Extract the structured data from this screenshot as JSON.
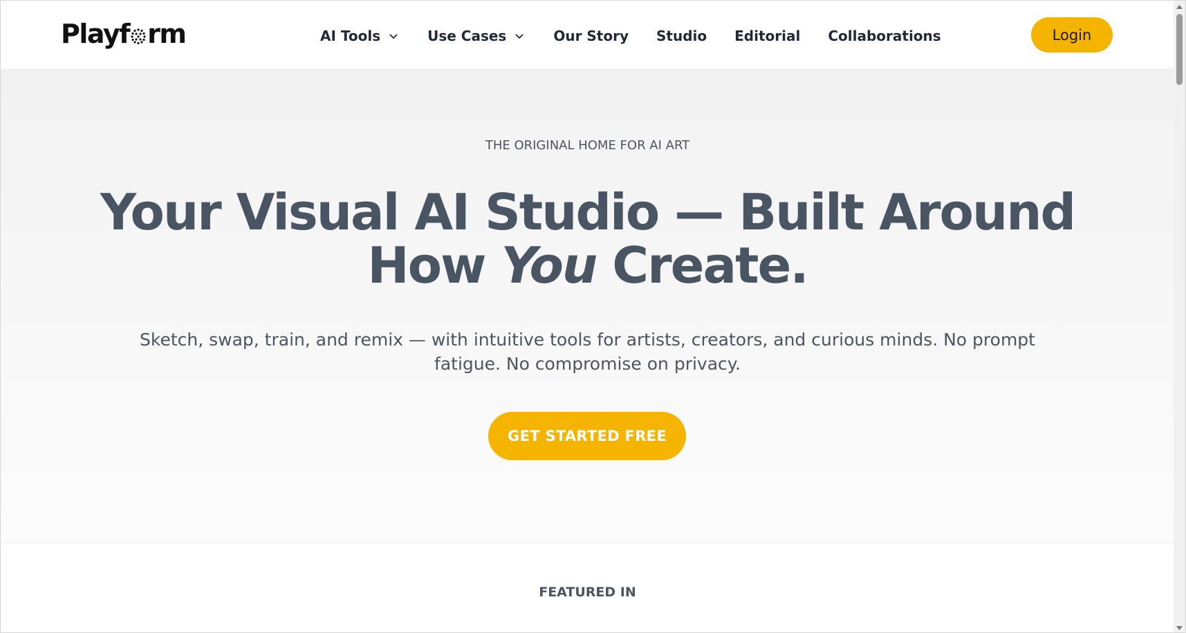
{
  "header": {
    "logo_prefix": "Playf",
    "logo_suffix": "rm",
    "nav": [
      {
        "label": "AI Tools",
        "has_dropdown": true
      },
      {
        "label": "Use Cases",
        "has_dropdown": true
      },
      {
        "label": "Our Story",
        "has_dropdown": false
      },
      {
        "label": "Studio",
        "has_dropdown": false
      },
      {
        "label": "Editorial",
        "has_dropdown": false
      },
      {
        "label": "Collaborations",
        "has_dropdown": false
      }
    ],
    "login_label": "Login"
  },
  "hero": {
    "eyebrow": "THE ORIGINAL HOME FOR AI ART",
    "headline_line1": "Your Visual AI Studio — Built Around",
    "headline_how": "How",
    "headline_you": "You",
    "headline_create": "Create.",
    "subtext": "Sketch, swap, train, and remix — with intuitive tools for artists, creators, and curious minds. No prompt fatigue. No compromise on privacy.",
    "cta_label": "GET STARTED FREE"
  },
  "featured": {
    "label": "FEATURED IN"
  },
  "colors": {
    "accent": "#f4b400",
    "text_dark": "#4a5563",
    "nav_text": "#1f2937"
  },
  "icons": {
    "logo_mark": "dot-grid-o-icon",
    "dropdown": "chevron-down-icon",
    "scroll_up": "arrow-up-icon",
    "scroll_down": "arrow-down-icon"
  }
}
